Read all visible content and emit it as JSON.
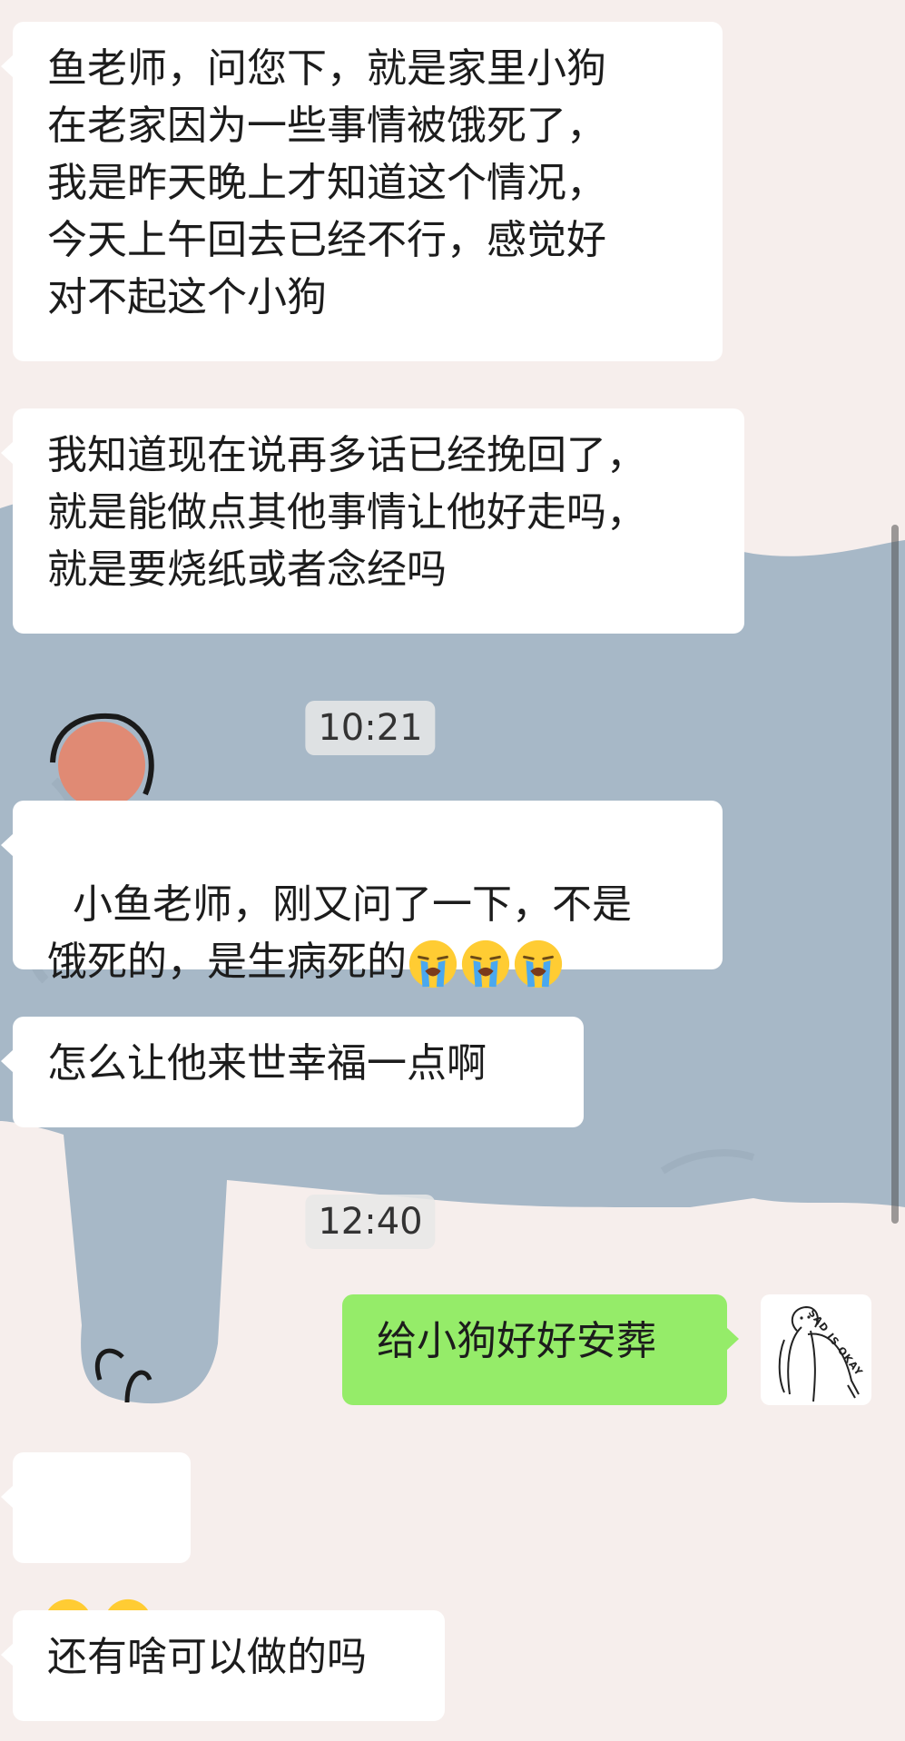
{
  "messages": [
    {
      "type": "in",
      "text": "鱼老师，问您下，就是家里小狗\n在老家因为一些事情被饿死了，\n我是昨天晚上才知道这个情况，\n今天上午回去已经不行，感觉好\n对不起这个小狗"
    },
    {
      "type": "in",
      "text": "我知道现在说再多话已经挽回了，\n就是能做点其他事情让他好走吗，\n就是要烧纸或者念经吗"
    },
    {
      "type": "time",
      "text": "10:21"
    },
    {
      "type": "in",
      "text": "小鱼老师，刚又问了一下，不是\n饿死的，是生病死的",
      "emojis": [
        "loudly-crying-face",
        "loudly-crying-face",
        "loudly-crying-face"
      ]
    },
    {
      "type": "in",
      "text": "怎么让他来世幸福一点啊"
    },
    {
      "type": "time",
      "text": "12:40"
    },
    {
      "type": "out",
      "text": "给小狗好好安葬"
    },
    {
      "type": "in",
      "text": "",
      "emojis": [
        "loudly-crying-face",
        "loudly-crying-face"
      ]
    },
    {
      "type": "in",
      "text": "还有啥可以做的吗"
    }
  ],
  "avatar": {
    "caption": "SAD IS OKAY",
    "icon": "sad-figure-illustration"
  },
  "colors": {
    "outgoing_bubble": "#95ec69",
    "incoming_bubble": "#ffffff",
    "background": "#f6eeec"
  }
}
